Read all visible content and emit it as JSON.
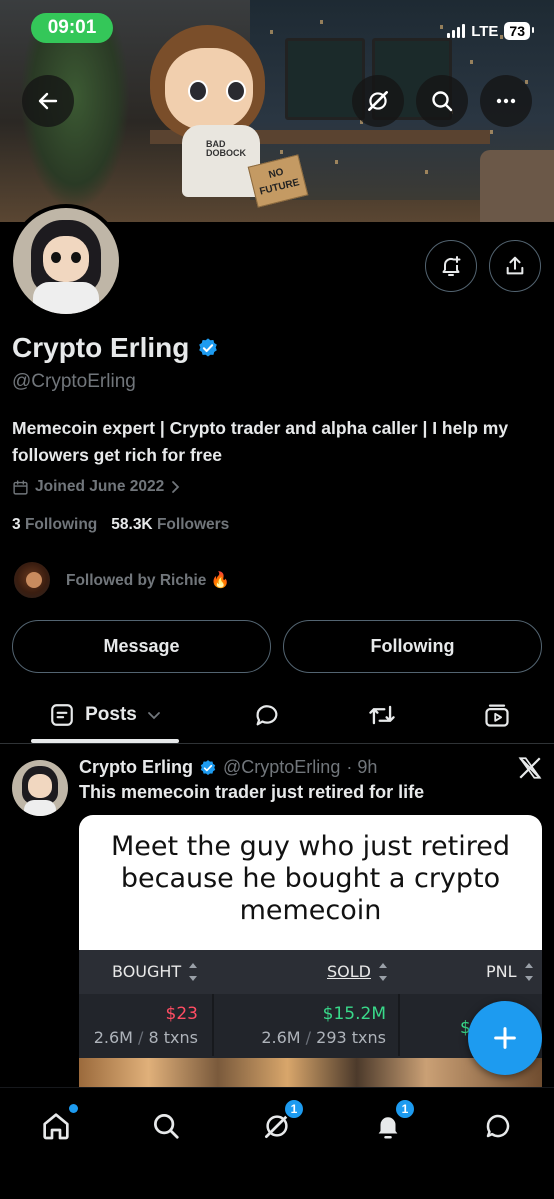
{
  "status_bar": {
    "time": "09:01",
    "network": "LTE",
    "battery": "73"
  },
  "banner": {
    "shirt_text": "BAD\nDOBOCK",
    "sign_text": "NO FUTURE"
  },
  "profile": {
    "name": "Crypto Erling",
    "handle": "@CryptoErling",
    "verified": true,
    "bio": "Memecoin expert | Crypto trader and alpha caller | I help my followers get rich for free",
    "joined": "Joined June 2022",
    "following_count": "3",
    "following_label": "Following",
    "followers_count": "58.3K",
    "followers_label": "Followers",
    "followed_by": "Followed by Richie 🔥"
  },
  "actions": {
    "message_label": "Message",
    "following_label": "Following"
  },
  "tabs": {
    "posts_label": "Posts"
  },
  "post": {
    "author_name": "Crypto Erling",
    "author_handle": "@CryptoErling",
    "time": "· 9h",
    "text": "This memecoin trader just retired for life",
    "media": {
      "title": "Meet the guy who just retired because he bought a crypto memecoin",
      "columns": [
        "BOUGHT",
        "SOLD",
        "PNL"
      ],
      "bought_value": "$23",
      "bought_sub": "2.6M",
      "bought_txns": "8 txns",
      "sold_value": "$15.2M",
      "sold_sub": "2.6M",
      "sold_txns": "293 txns",
      "pnl_value": "$"
    }
  },
  "bottom_nav": {
    "messages_badge": "1",
    "notifications_badge": "1"
  },
  "colors": {
    "accent": "#1d9bf0",
    "time_pill": "#34c759",
    "text_primary": "#e7e9ea",
    "text_secondary": "#71767b",
    "border": "#536471"
  }
}
